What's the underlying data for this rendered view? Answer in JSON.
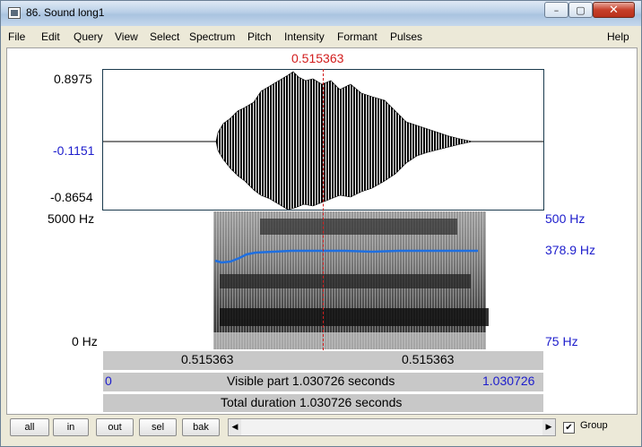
{
  "window": {
    "title": "86. Sound long1",
    "minimize": "–",
    "maximize": "▢",
    "close": "✕"
  },
  "menu": [
    "File",
    "Edit",
    "Query",
    "View",
    "Select",
    "Spectrum",
    "Pitch",
    "Intensity",
    "Formant",
    "Pulses",
    "Help"
  ],
  "cursor": {
    "time_label": "0.515363",
    "position_fraction": 0.5,
    "color": "#d21c1c"
  },
  "waveform": {
    "max_label": "0.8975",
    "mid_label": "-0.1151",
    "min_label": "-0.8654",
    "max": 0.8975,
    "mid": -0.1151,
    "min": -0.8654
  },
  "spectrogram": {
    "freq_top_label": "5000 Hz",
    "freq_bottom_label": "0 Hz",
    "pitch_top_label": "500 Hz",
    "pitch_current_label": "378.9 Hz",
    "pitch_bottom_label": "75 Hz",
    "pitch_color": "#1f6fe0"
  },
  "selection": {
    "left_label": "0.515363",
    "right_label": "0.515363"
  },
  "visible": {
    "start": "0",
    "text": "Visible part 1.030726 seconds",
    "end": "1.030726"
  },
  "total": {
    "text": "Total duration 1.030726 seconds"
  },
  "toolbar": {
    "buttons": [
      "all",
      "in",
      "out",
      "sel",
      "bak"
    ],
    "scroll_left": "◀",
    "scroll_right": "▶",
    "group_label": "Group",
    "group_checked": "✔"
  }
}
